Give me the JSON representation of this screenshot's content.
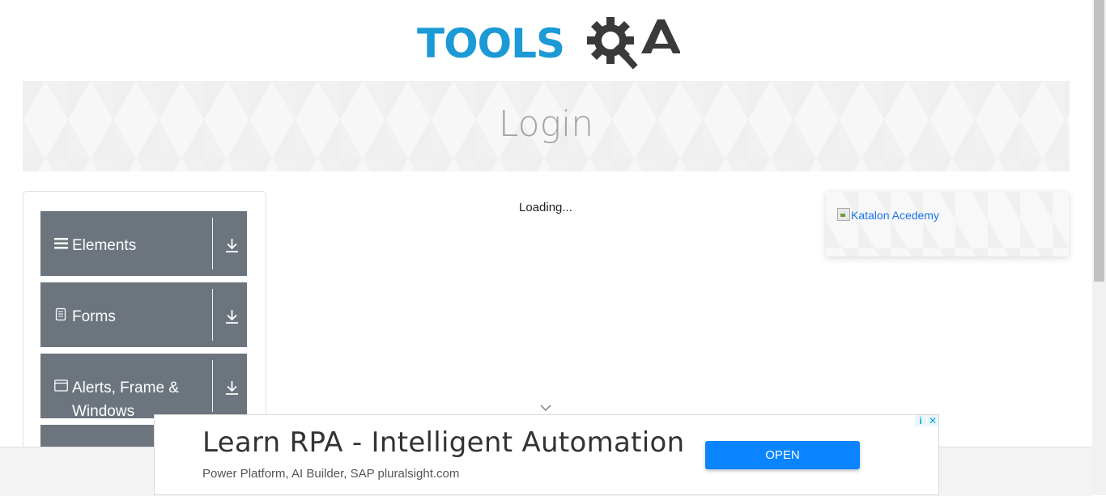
{
  "header": {
    "logo_text": "TOOLS",
    "logo_alt": "ToolsQA"
  },
  "page": {
    "title": "Login"
  },
  "sidebar": {
    "groups": [
      {
        "label": "Elements",
        "icon": "menu-bars-icon"
      },
      {
        "label": "Forms",
        "icon": "document-icon"
      },
      {
        "label": "Alerts, Frame & Windows",
        "icon": "window-icon"
      }
    ]
  },
  "main": {
    "loading_text": "Loading...",
    "scroll_indicator": "chevron-down-icon"
  },
  "right_ad": {
    "link_text": "Katalon Acedemy"
  },
  "bottom_ad": {
    "headline": "Learn RPA - Intelligent Automation",
    "subtext": "Power Platform, AI Builder, SAP pluralsight.com",
    "button_label": "OPEN",
    "info_glyph": "i",
    "close_glyph": "✕"
  },
  "colors": {
    "brand_blue": "#1b9ad6",
    "logo_dark": "#3a3a3a",
    "sidebar_bg": "#6c757d",
    "open_button": "#0a84ff"
  }
}
